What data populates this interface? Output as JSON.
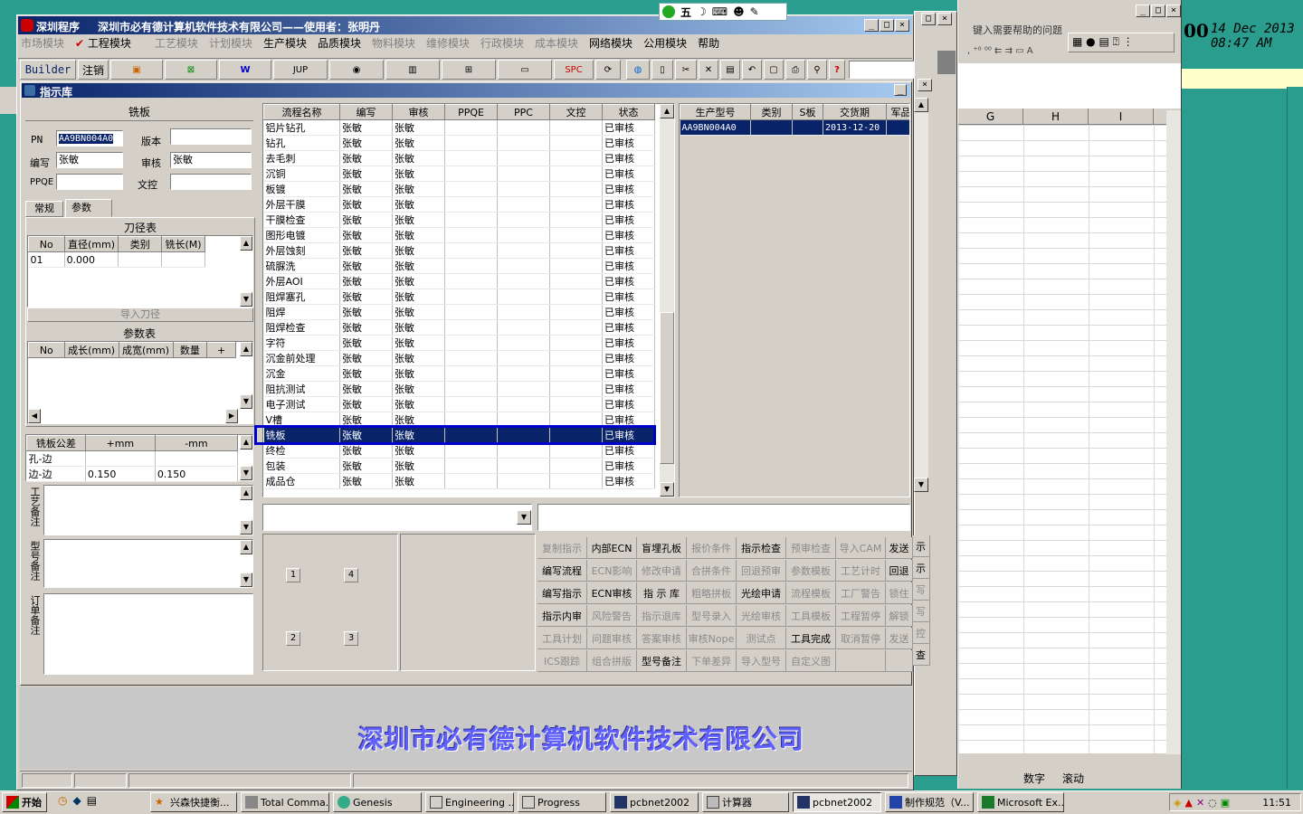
{
  "main_window": {
    "title_app": "深圳程序",
    "title_company": "深圳市必有德计算机软件技术有限公司——使用者：张明丹",
    "menu": [
      "市场模块",
      "工程模块",
      "工艺模块",
      "计划模块",
      "生产模块",
      "品质模块",
      "物料模块",
      "维修模块",
      "行政模块",
      "成本模块",
      "网络模块",
      "公用模块",
      "帮助"
    ],
    "toolbar": {
      "builder": "Builder",
      "logout": "注销",
      "jup": "JUP",
      "spc": "SPC"
    }
  },
  "ime_bar": {
    "label": "五"
  },
  "child_window": {
    "title": "指示库"
  },
  "left_panel": {
    "header": "铣板",
    "pn_label": "PN",
    "pn_value": "AA9BN004A0",
    "version_label": "版本",
    "version_value": "",
    "author_label": "编写",
    "author_value": "张敏",
    "reviewer_label": "审核",
    "reviewer_value": "张敏",
    "ppqe_label": "PPQE",
    "ppqe_value": "",
    "doc_label": "文控",
    "doc_value": "",
    "tabs": [
      "常规",
      "参数"
    ],
    "tool_table_title": "刀径表",
    "tool_cols": [
      "No",
      "直径(mm)",
      "类别",
      "铣长(M)"
    ],
    "tool_rows": [
      [
        "01",
        "0.000",
        "",
        ""
      ]
    ],
    "import_tool_btn": "导入刀径",
    "param_table_title": "参数表",
    "param_cols": [
      "No",
      "成长(mm)",
      "成宽(mm)",
      "数量",
      "+"
    ],
    "tol_cols": [
      "铣板公差",
      "+mm",
      "-mm"
    ],
    "tol_rows": [
      [
        "孔-边",
        "",
        ""
      ],
      [
        "边-边",
        "0.150",
        "0.150"
      ]
    ],
    "note_labels": [
      "工艺备注",
      "型号备注",
      "订单备注"
    ]
  },
  "process_grid": {
    "cols": [
      "流程名称",
      "编写",
      "审核",
      "PPQE",
      "PPC",
      "文控",
      "状态"
    ],
    "selected_index": 20,
    "rows": [
      [
        "铝片钻孔",
        "张敏",
        "张敏",
        "",
        "",
        "",
        "已审核"
      ],
      [
        "钻孔",
        "张敏",
        "张敏",
        "",
        "",
        "",
        "已审核"
      ],
      [
        "去毛刺",
        "张敏",
        "张敏",
        "",
        "",
        "",
        "已审核"
      ],
      [
        "沉铜",
        "张敏",
        "张敏",
        "",
        "",
        "",
        "已审核"
      ],
      [
        "板镀",
        "张敏",
        "张敏",
        "",
        "",
        "",
        "已审核"
      ],
      [
        "外层干膜",
        "张敏",
        "张敏",
        "",
        "",
        "",
        "已审核"
      ],
      [
        "干膜检查",
        "张敏",
        "张敏",
        "",
        "",
        "",
        "已审核"
      ],
      [
        "图形电镀",
        "张敏",
        "张敏",
        "",
        "",
        "",
        "已审核"
      ],
      [
        "外层蚀刻",
        "张敏",
        "张敏",
        "",
        "",
        "",
        "已审核"
      ],
      [
        "硫脲洗",
        "张敏",
        "张敏",
        "",
        "",
        "",
        "已审核"
      ],
      [
        "外层AOI",
        "张敏",
        "张敏",
        "",
        "",
        "",
        "已审核"
      ],
      [
        "阻焊塞孔",
        "张敏",
        "张敏",
        "",
        "",
        "",
        "已审核"
      ],
      [
        "阻焊",
        "张敏",
        "张敏",
        "",
        "",
        "",
        "已审核"
      ],
      [
        "阻焊检查",
        "张敏",
        "张敏",
        "",
        "",
        "",
        "已审核"
      ],
      [
        "字符",
        "张敏",
        "张敏",
        "",
        "",
        "",
        "已审核"
      ],
      [
        "沉金前处理",
        "张敏",
        "张敏",
        "",
        "",
        "",
        "已审核"
      ],
      [
        "沉金",
        "张敏",
        "张敏",
        "",
        "",
        "",
        "已审核"
      ],
      [
        "阻抗测试",
        "张敏",
        "张敏",
        "",
        "",
        "",
        "已审核"
      ],
      [
        "电子测试",
        "张敏",
        "张敏",
        "",
        "",
        "",
        "已审核"
      ],
      [
        "V槽",
        "张敏",
        "张敏",
        "",
        "",
        "",
        "已审核"
      ],
      [
        "铣板",
        "张敏",
        "张敏",
        "",
        "",
        "",
        "已审核"
      ],
      [
        "终检",
        "张敏",
        "张敏",
        "",
        "",
        "",
        "已审核"
      ],
      [
        "包装",
        "张敏",
        "张敏",
        "",
        "",
        "",
        "已审核"
      ],
      [
        "成品仓",
        "张敏",
        "张敏",
        "",
        "",
        "",
        "已审核"
      ]
    ]
  },
  "product_grid": {
    "cols": [
      "生产型号",
      "类别",
      "S板",
      "交货期",
      "军品"
    ],
    "rows": [
      [
        "AA9BN004A0",
        "",
        "",
        "2013-12-20",
        ""
      ]
    ]
  },
  "step_buttons": [
    "1",
    "4",
    "2",
    "3"
  ],
  "commands": [
    [
      "复制指示",
      "内部ECN",
      "盲埋孔板",
      "报价条件",
      "指示检查",
      "预审检查",
      "导入CAM",
      "发送"
    ],
    [
      "编写流程",
      "ECN影响",
      "修改申请",
      "合拼条件",
      "回退预审",
      "参数模板",
      "工艺计时",
      "回退"
    ],
    [
      "编写指示",
      "ECN审核",
      "指 示 库",
      "粗略拼板",
      "光绘申请",
      "流程模板",
      "工厂警告",
      "锁住"
    ],
    [
      "指示内审",
      "风险警告",
      "指示退库",
      "型号录入",
      "光绘审核",
      "工具模板",
      "工程暂停",
      "解锁"
    ],
    [
      "工具计划",
      "问题审核",
      "答案审核",
      "审核Nope",
      "测试点",
      "工具完成",
      "取消暂停",
      "发送"
    ],
    [
      "ICS跟踪",
      "组合拼版",
      "型号备注",
      "下单差异",
      "导入型号",
      "自定义图",
      "",
      ""
    ]
  ],
  "command_enabled": [
    [
      false,
      true,
      true,
      false,
      true,
      false,
      false,
      true
    ],
    [
      true,
      false,
      false,
      false,
      false,
      false,
      false,
      true
    ],
    [
      true,
      true,
      true,
      false,
      true,
      false,
      false,
      false
    ],
    [
      true,
      false,
      false,
      false,
      false,
      false,
      false,
      false
    ],
    [
      false,
      false,
      false,
      false,
      false,
      true,
      false,
      false
    ],
    [
      false,
      false,
      true,
      false,
      false,
      false,
      false,
      false
    ]
  ],
  "side_commands": [
    "示",
    "示",
    "写",
    "写",
    "控",
    "查"
  ],
  "footer_company": "深圳市必有德计算机软件技术有限公司",
  "excel": {
    "help_placeholder": "键入需要帮助的问题",
    "cols": [
      "G",
      "H",
      "I"
    ],
    "status_num": "数字",
    "status_scroll": "滚动"
  },
  "clock": {
    "date": "14 Dec 2013",
    "time": "08:47 AM",
    "prefix": "00"
  },
  "taskbar": {
    "start": "开始",
    "items": [
      "兴森快捷衡...",
      "Total Comma...",
      "Genesis",
      "Engineering ...",
      "Progress",
      "pcbnet2002",
      "计算器",
      "pcbnet2002",
      "制作规范（V...",
      "Microsoft Ex..."
    ],
    "time": "11:51"
  },
  "colors": {
    "title_blue": "#0a246a",
    "selection_navy": "#0a246a",
    "highlight_box": "#0000cc",
    "footer_text": "#6060ff"
  }
}
